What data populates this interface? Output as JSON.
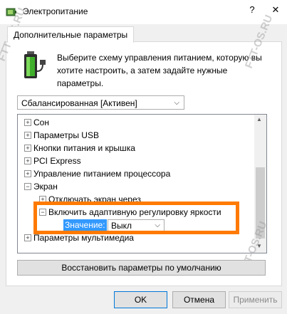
{
  "window": {
    "title": "Электропитание",
    "help_glyph": "?",
    "close_glyph": "✕"
  },
  "tab": {
    "label": "Дополнительные параметры"
  },
  "description": "Выберите схему управления питанием, которую вы хотите настроить, а затем задайте нужные параметры.",
  "scheme": {
    "selected": "Сбалансированная [Активен]"
  },
  "tree": {
    "items": [
      {
        "expander": "+",
        "label": "Сон"
      },
      {
        "expander": "+",
        "label": "Параметры USB"
      },
      {
        "expander": "+",
        "label": "Кнопки питания и крышка"
      },
      {
        "expander": "+",
        "label": "PCI Express"
      },
      {
        "expander": "+",
        "label": "Управление питанием процессора"
      },
      {
        "expander": "−",
        "label": "Экран"
      },
      {
        "expander": "+",
        "label": "Отключать экран через"
      },
      {
        "expander": "−",
        "label": "Включить адаптивную регулировку яркости"
      },
      {
        "expander": "+",
        "label": "Параметры мультимедиа"
      }
    ],
    "value_label": "Значение:",
    "value_selected": "Выкл"
  },
  "buttons": {
    "restore": "Восстановить параметры по умолчанию",
    "ok": "OK",
    "cancel": "Отмена",
    "apply": "Применить"
  },
  "watermark": "FTT-OS.RU",
  "colors": {
    "highlight": "#ff7a00",
    "selection": "#3399ff"
  }
}
